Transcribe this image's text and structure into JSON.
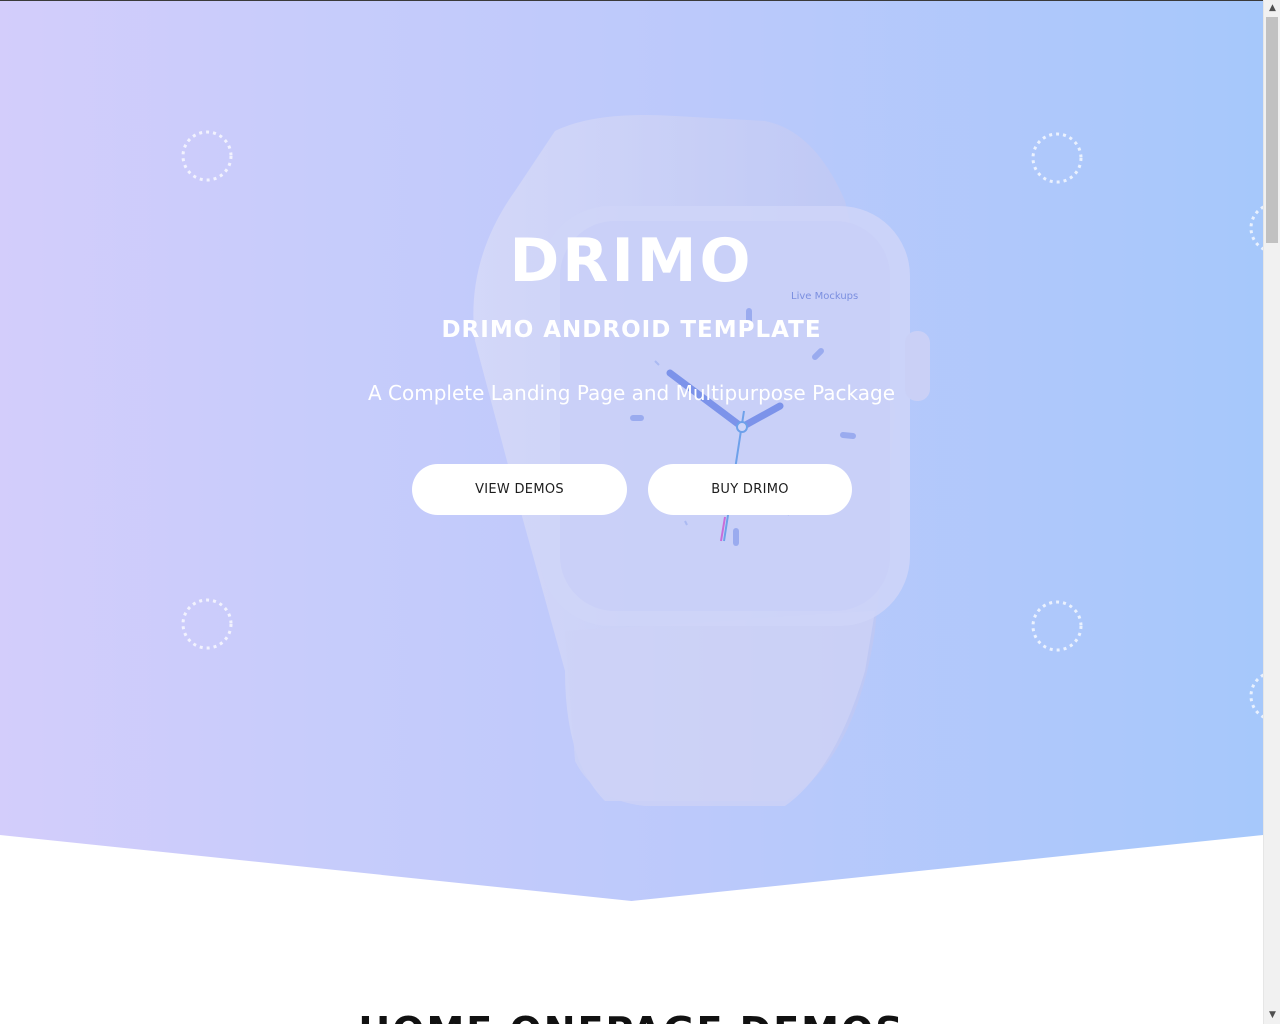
{
  "hero": {
    "brand": "DRIMO",
    "subtitle": "DRIMO ANDROID TEMPLATE",
    "tagline": "A Complete Landing Page and Multipurpose Package",
    "watch_label": "Live Mockups",
    "buttons": {
      "view_demos": "VIEW DEMOS",
      "buy": "BUY DRIMO"
    },
    "colors": {
      "gradient_start": "#d3cdfb",
      "gradient_end": "#a6c8fb"
    }
  },
  "section": {
    "title": "HOME ONEPAGE DEMOS"
  },
  "scrollbar": {
    "up_icon": "arrow-up-icon",
    "down_icon": "arrow-down-icon"
  }
}
